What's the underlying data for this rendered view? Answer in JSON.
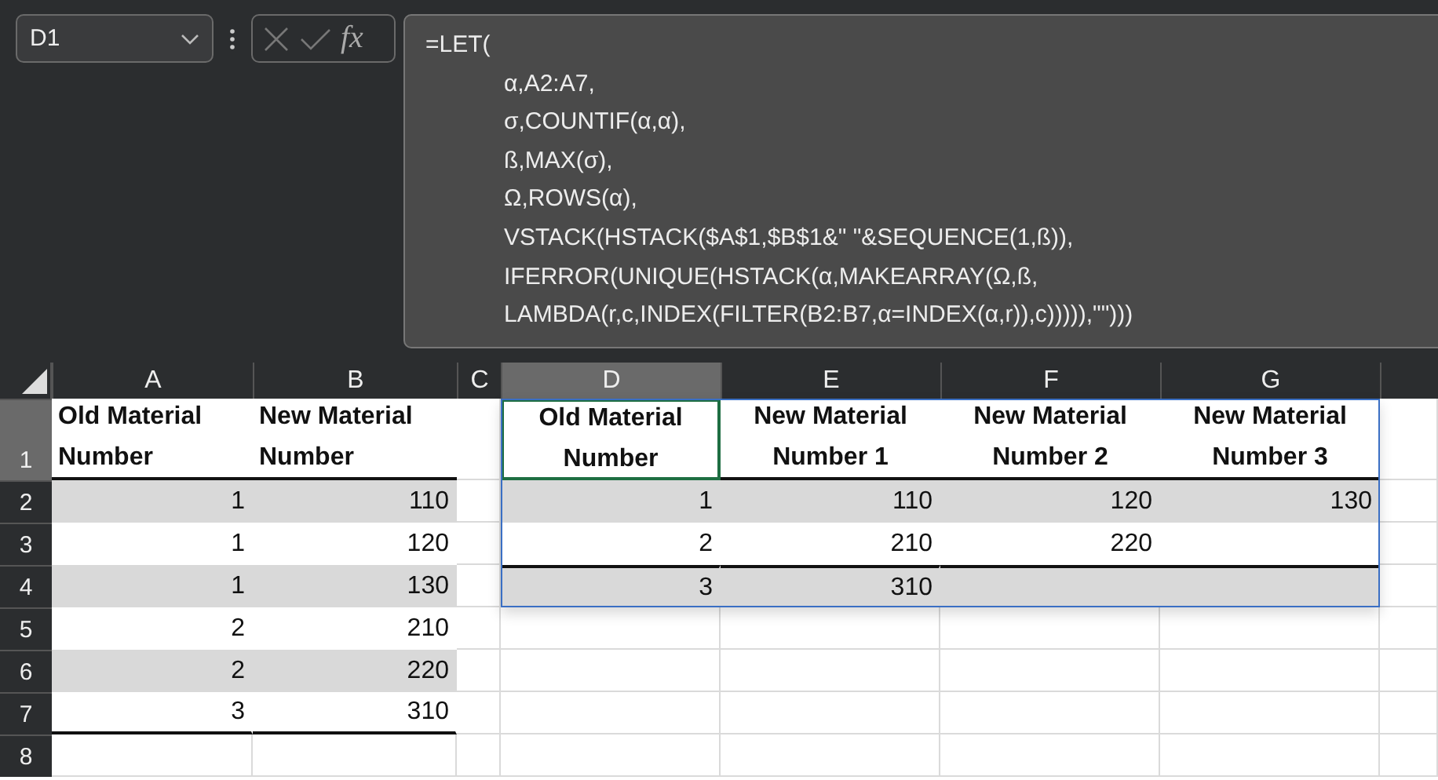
{
  "name_box": {
    "value": "D1"
  },
  "formula_bar": {
    "fx": "fx",
    "opening": "=LET(",
    "lines": [
      "α,A2:A7,",
      "σ,COUNTIF(α,α),",
      "ß,MAX(σ),",
      "Ω,ROWS(α),",
      "VSTACK(HSTACK($A$1,$B$1&\" \"&SEQUENCE(1,ß)),",
      "IFERROR(UNIQUE(HSTACK(α,MAKEARRAY(Ω,ß,",
      "LAMBDA(r,c,INDEX(FILTER(B2:B7,α=INDEX(α,r)),c))))),\"\")))"
    ]
  },
  "columns": [
    {
      "label": "A",
      "selected": false
    },
    {
      "label": "B",
      "selected": false
    },
    {
      "label": "C",
      "selected": false
    },
    {
      "label": "D",
      "selected": true
    },
    {
      "label": "E",
      "selected": false
    },
    {
      "label": "F",
      "selected": false
    },
    {
      "label": "G",
      "selected": false
    }
  ],
  "row_numbers": [
    {
      "label": "1",
      "selected": true
    },
    {
      "label": "2",
      "selected": false
    },
    {
      "label": "3",
      "selected": false
    },
    {
      "label": "4",
      "selected": false
    },
    {
      "label": "5",
      "selected": false
    },
    {
      "label": "6",
      "selected": false
    },
    {
      "label": "7",
      "selected": false
    },
    {
      "label": "8",
      "selected": false
    }
  ],
  "source_table": {
    "headers": [
      {
        "text": "Old Material Number",
        "selected": false
      },
      {
        "text": "New Material Number",
        "selected": false
      }
    ],
    "rows": [
      [
        "1",
        "110"
      ],
      [
        "1",
        "120"
      ],
      [
        "1",
        "130"
      ],
      [
        "2",
        "210"
      ],
      [
        "2",
        "220"
      ],
      [
        "3",
        "310"
      ]
    ]
  },
  "result_table": {
    "headers": [
      {
        "text": "Old Material Number",
        "selected": true
      },
      {
        "text": "New Material Number 1",
        "selected": false
      },
      {
        "text": "New Material Number 2",
        "selected": false
      },
      {
        "text": "New Material Number 3",
        "selected": false
      }
    ],
    "rows": [
      [
        "1",
        "110",
        "120",
        "130"
      ],
      [
        "2",
        "210",
        "220"
      ],
      [
        "3",
        "310"
      ]
    ]
  }
}
